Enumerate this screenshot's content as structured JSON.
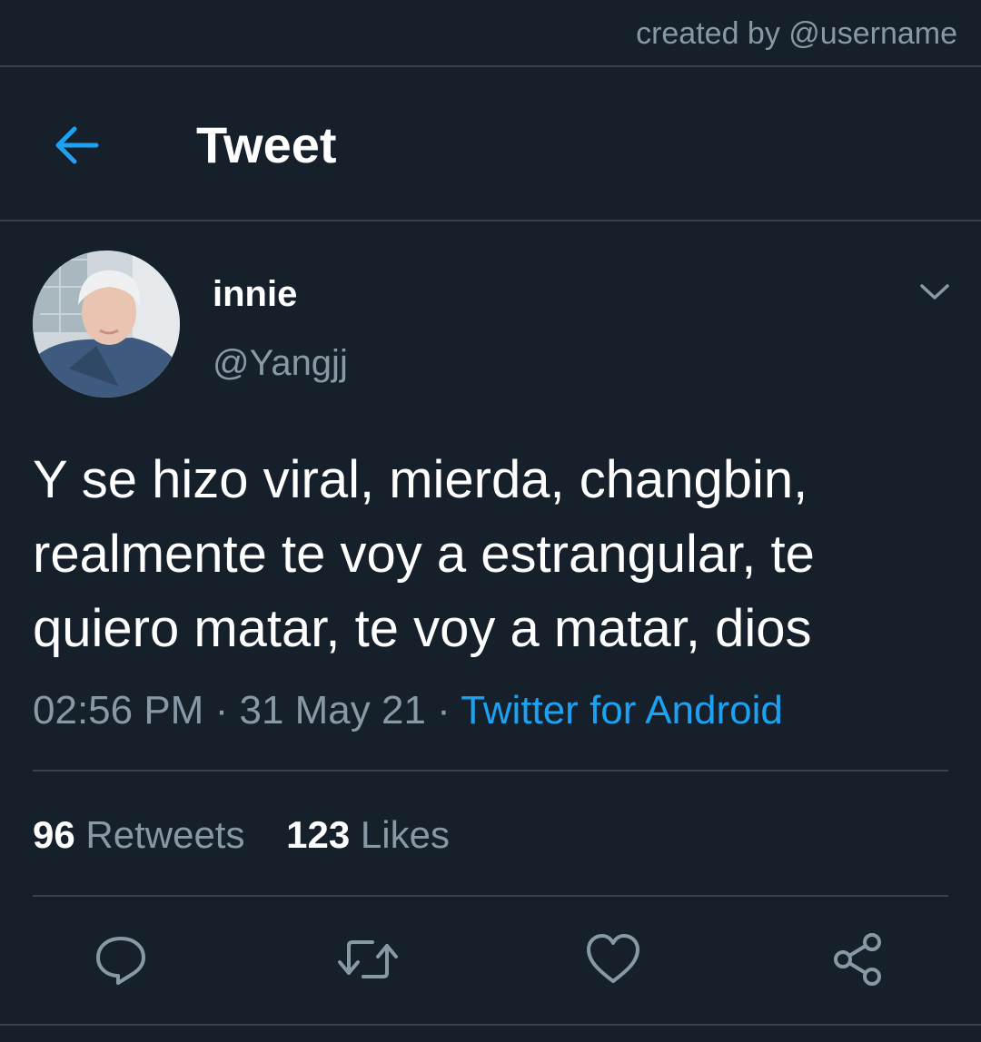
{
  "watermark": "created by @username",
  "header": {
    "title": "Tweet",
    "back_icon": "arrow-left-icon"
  },
  "author": {
    "display_name": "innie",
    "handle": "@Yangjj",
    "avatar": "profile-photo"
  },
  "tweet": {
    "text": "Y se hizo viral, mierda, changbin, realmente te voy a estrangular, te quiero matar, te voy a matar, dios",
    "time": "02:56 PM",
    "date": "31 May 21",
    "separator": "·",
    "source": "Twitter for Android"
  },
  "stats": {
    "retweets_count": "96",
    "retweets_label": "Retweets",
    "likes_count": "123",
    "likes_label": "Likes"
  },
  "actions": [
    {
      "icon": "reply-icon"
    },
    {
      "icon": "retweet-icon"
    },
    {
      "icon": "like-heart-icon"
    },
    {
      "icon": "share-icon"
    }
  ],
  "colors": {
    "background": "#15202b",
    "accent": "#1da1f2",
    "secondary_text": "#8899a6",
    "divider": "#38444d"
  }
}
